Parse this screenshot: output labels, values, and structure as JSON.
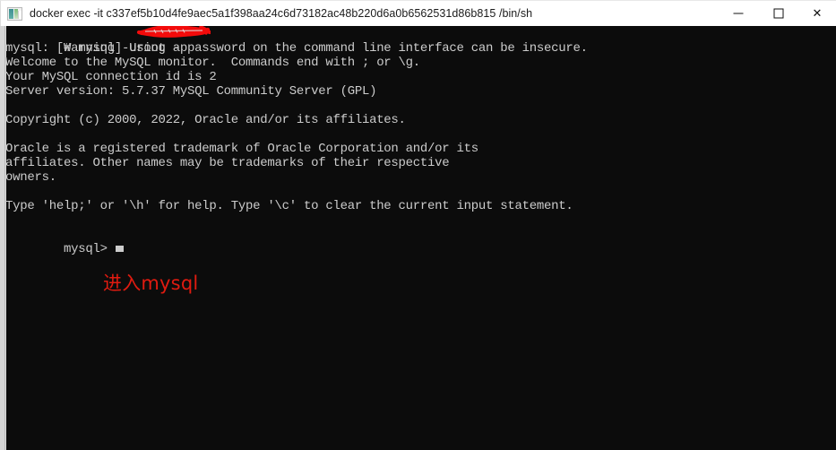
{
  "window": {
    "title": "docker  exec -it c337ef5b10d4fe9aec5a1f398aa24c6d73182ac48b220d6a0b6562531d86b815 /bin/sh",
    "icon": "console-app-icon",
    "controls": {
      "minimize_label": "—",
      "maximize_label": "",
      "close_label": "✕"
    },
    "colors": {
      "titlebar_background": "#ffffff",
      "titlebar_text": "#1b1b1b",
      "terminal_background": "#0c0c0c",
      "terminal_text": "#cccccc",
      "annotation_red": "#e01b10",
      "redaction_red": "#f30b0b"
    }
  },
  "terminal": {
    "prompt_symbol": "#",
    "command": "# mysql -uroot -p",
    "redacted_password_note": "password-scribbled-out",
    "lines": [
      "mysql: [Warning] Using a password on the command line interface can be insecure.",
      "Welcome to the MySQL monitor.  Commands end with ; or \\g.",
      "Your MySQL connection id is 2",
      "Server version: 5.7.37 MySQL Community Server (GPL)",
      "",
      "Copyright (c) 2000, 2022, Oracle and/or its affiliates.",
      "",
      "Oracle is a registered trademark of Oracle Corporation and/or its",
      "affiliates. Other names may be trademarks of their respective",
      "owners.",
      "",
      "Type 'help;' or '\\h' for help. Type '\\c' to clear the current input statement.",
      ""
    ],
    "mysql_prompt": "mysql>",
    "cursor": "block-cursor"
  },
  "annotation": {
    "text": "进入mysql"
  }
}
